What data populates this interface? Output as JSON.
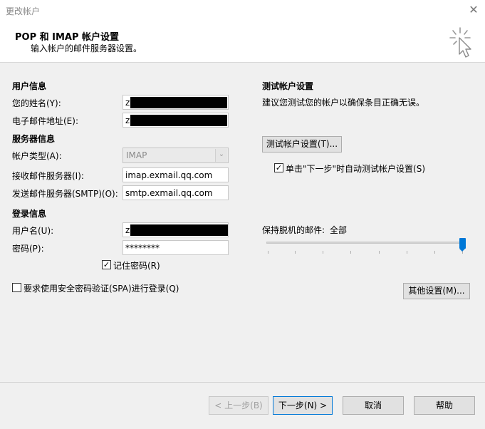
{
  "window": {
    "title": "更改帐户",
    "close_icon": "✕"
  },
  "header": {
    "title": "POP 和 IMAP 帐户设置",
    "subtitle": "输入帐户的邮件服务器设置。",
    "icon": "cursor-click-icon"
  },
  "user_info": {
    "section_title": "用户信息",
    "name_label": "您的姓名(Y):",
    "name_value": "z",
    "email_label": "电子邮件地址(E):",
    "email_value": "z"
  },
  "server_info": {
    "section_title": "服务器信息",
    "account_type_label": "帐户类型(A):",
    "account_type_value": "IMAP",
    "incoming_label": "接收邮件服务器(I):",
    "incoming_value": "imap.exmail.qq.com",
    "outgoing_label": "发送邮件服务器(SMTP)(O):",
    "outgoing_value": "smtp.exmail.qq.com"
  },
  "login_info": {
    "section_title": "登录信息",
    "username_label": "用户名(U):",
    "username_value": "z",
    "password_label": "密码(P):",
    "password_value": "********",
    "remember_label": "记住密码(R)",
    "remember_checked": true
  },
  "spa": {
    "label": "要求使用安全密码验证(SPA)进行登录(Q)",
    "checked": false
  },
  "test_settings": {
    "section_title": "测试帐户设置",
    "description": "建议您测试您的帐户以确保条目正确无误。",
    "test_button": "测试帐户设置(T)...",
    "auto_test_label": "单击\"下一步\"时自动测试帐户设置(S)",
    "auto_test_checked": true
  },
  "offline": {
    "label": "保持脱机的邮件:",
    "value": "全部",
    "slider_level": 1.0
  },
  "more_settings_button": "其他设置(M)...",
  "footer": {
    "back": "< 上一步(B)",
    "next": "下一步(N) >",
    "cancel": "取消",
    "help": "帮助"
  }
}
